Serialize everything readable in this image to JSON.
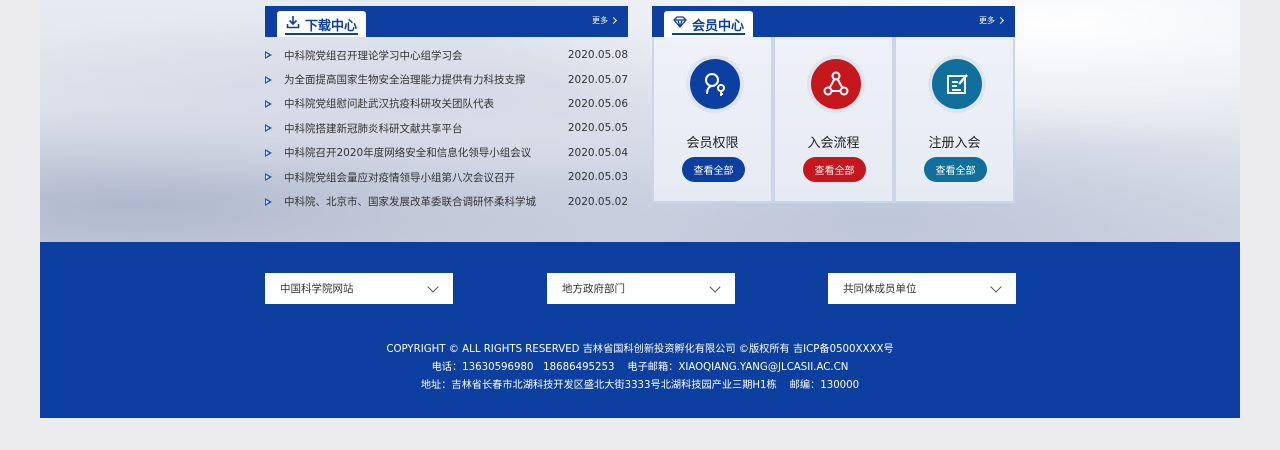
{
  "download": {
    "title": "下载中心",
    "more": "更多",
    "items": [
      {
        "title": "中科院党组召开理论学习中心组学习会",
        "date": "2020.05.08"
      },
      {
        "title": "为全面提高国家生物安全治理能力提供有力科技支撑",
        "date": "2020.05.07"
      },
      {
        "title": "中科院党组慰问赴武汉抗疫科研攻关团队代表",
        "date": "2020.05.06"
      },
      {
        "title": "中科院搭建新冠肺炎科研文献共享平台",
        "date": "2020.05.05"
      },
      {
        "title": "中科院召开2020年度网络安全和信息化领导小组会议",
        "date": "2020.05.04"
      },
      {
        "title": "中科院党组会量应对疫情领导小组第八次会议召开",
        "date": "2020.05.03"
      },
      {
        "title": "中科院、北京市、国家发展改革委联合调研怀柔科学城",
        "date": "2020.05.02"
      }
    ]
  },
  "member": {
    "title": "会员中心",
    "more": "更多",
    "cards": [
      {
        "label": "会员权限",
        "button": "查看全部",
        "icon": "key-person-icon",
        "color": "#0c3f9f"
      },
      {
        "label": "入会流程",
        "button": "查看全部",
        "icon": "process-network-icon",
        "color": "#c4181e"
      },
      {
        "label": "注册入会",
        "button": "查看全部",
        "icon": "register-edit-icon",
        "color": "#116f9c"
      }
    ]
  },
  "footer": {
    "selects": [
      "中国科学院网站",
      "地方政府部门",
      "共同体成员单位"
    ],
    "copyright": "COPYRIGHT © ALL RIGHTS RESERVED 吉林省国科创新投资孵化有限公司 ©版权所有 吉ICP备0500XXXX号",
    "contact": "电话：13630596980   18686495253    电子邮箱：XIAOQIANG.YANG@JLCASII.AC.CN",
    "address": "地址：吉林省长春市北湖科技开发区盛北大街3333号北湖科技园产业三期H1栋    邮编：130000"
  },
  "colors": {
    "brand_blue": "#0c3f9f",
    "red": "#c4181e",
    "teal": "#116f9c"
  }
}
